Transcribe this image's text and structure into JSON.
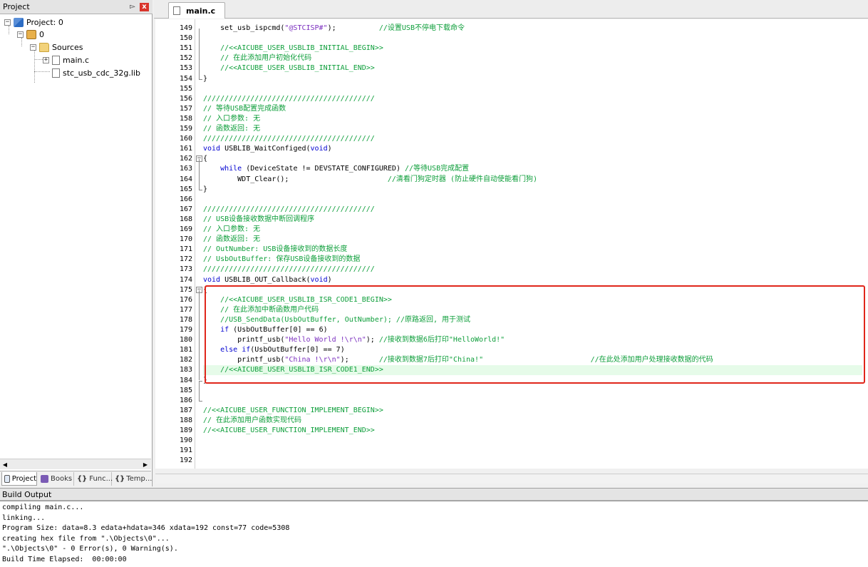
{
  "project_panel": {
    "title": "Project",
    "tree": {
      "project_label": "Project: 0",
      "target_label": "0",
      "group_label": "Sources",
      "files": [
        "main.c",
        "stc_usb_cdc_32g.lib"
      ]
    },
    "tabs": [
      "Project",
      "Books",
      "Func...",
      "Temp..."
    ]
  },
  "editor": {
    "active_tab": "main.c",
    "lines": [
      {
        "n": "149",
        "text": "    set_usb_ispcmd(\"@STCISP#\");          //设置USB不停电下载命令"
      },
      {
        "n": "150",
        "text": ""
      },
      {
        "n": "151",
        "text": "    //<<AICUBE_USER_USBLIB_INITIAL_BEGIN>>"
      },
      {
        "n": "152",
        "text": "    // 在此添加用户初始化代码"
      },
      {
        "n": "153",
        "text": "    //<<AICUBE_USER_USBLIB_INITIAL_END>>"
      },
      {
        "n": "154",
        "text": "}"
      },
      {
        "n": "155",
        "text": ""
      },
      {
        "n": "156",
        "text": "////////////////////////////////////////"
      },
      {
        "n": "157",
        "text": "// 等待USB配置完成函数"
      },
      {
        "n": "158",
        "text": "// 入口参数: 无"
      },
      {
        "n": "159",
        "text": "// 函数返回: 无"
      },
      {
        "n": "160",
        "text": "////////////////////////////////////////"
      },
      {
        "n": "161",
        "text": "void USBLIB_WaitConfiged(void)"
      },
      {
        "n": "162",
        "text": "{"
      },
      {
        "n": "163",
        "text": "    while (DeviceState != DEVSTATE_CONFIGURED) //等待USB完成配置"
      },
      {
        "n": "164",
        "text": "        WDT_Clear();                       //清看门狗定时器 (防止硬件自动使能看门狗)"
      },
      {
        "n": "165",
        "text": "}"
      },
      {
        "n": "166",
        "text": ""
      },
      {
        "n": "167",
        "text": "////////////////////////////////////////"
      },
      {
        "n": "168",
        "text": "// USB设备接收数据中断回调程序"
      },
      {
        "n": "169",
        "text": "// 入口参数: 无"
      },
      {
        "n": "170",
        "text": "// 函数返回: 无"
      },
      {
        "n": "171",
        "text": "// OutNumber: USB设备接收到的数据长度"
      },
      {
        "n": "172",
        "text": "// UsbOutBuffer: 保存USB设备接收到的数据"
      },
      {
        "n": "173",
        "text": "////////////////////////////////////////"
      },
      {
        "n": "174",
        "text": "void USBLIB_OUT_Callback(void)"
      },
      {
        "n": "175",
        "text": "{"
      },
      {
        "n": "176",
        "text": "    //<<AICUBE_USER_USBLIB_ISR_CODE1_BEGIN>>"
      },
      {
        "n": "177",
        "text": "    // 在此添加中断函数用户代码"
      },
      {
        "n": "178",
        "text": "    //USB_SendData(UsbOutBuffer, OutNumber); //原路返回, 用于测试"
      },
      {
        "n": "179",
        "text": "    if (UsbOutBuffer[0] == 6)"
      },
      {
        "n": "180",
        "text": "        printf_usb(\"Hello World !\\r\\n\"); //接收到数据6后打印\"HelloWorld!\""
      },
      {
        "n": "181",
        "text": "    else if(UsbOutBuffer[0] == 7)"
      },
      {
        "n": "182",
        "text": "        printf_usb(\"China !\\r\\n\");       //接收到数据7后打印\"China!\"                         //在此处添加用户处理接收数据的代码"
      },
      {
        "n": "183",
        "text": "    //<<AICUBE_USER_USBLIB_ISR_CODE1_END>>"
      },
      {
        "n": "184",
        "text": "}"
      },
      {
        "n": "185",
        "text": ""
      },
      {
        "n": "186",
        "text": ""
      },
      {
        "n": "187",
        "text": "//<<AICUBE_USER_FUNCTION_IMPLEMENT_BEGIN>>"
      },
      {
        "n": "188",
        "text": "// 在此添加用户函数实现代码"
      },
      {
        "n": "189",
        "text": "//<<AICUBE_USER_FUNCTION_IMPLEMENT_END>>"
      },
      {
        "n": "190",
        "text": ""
      },
      {
        "n": "191",
        "text": ""
      },
      {
        "n": "192",
        "text": ""
      }
    ]
  },
  "build_output": {
    "title": "Build Output",
    "lines": [
      "compiling main.c...",
      "linking...",
      "Program Size: data=8.3 edata+hdata=346 xdata=192 const=77 code=5308",
      "creating hex file from \".\\Objects\\0\"...",
      "\".\\Objects\\0\" - 0 Error(s), 0 Warning(s).",
      "Build Time Elapsed:  00:00:00"
    ]
  },
  "colors": {
    "comment": "#0d9e3a",
    "keyword": "#0000d0",
    "string": "#7b2fbf",
    "highlight_box": "#e0261b",
    "highlighted_line": "#e6fbe9"
  },
  "icons": {
    "panel_pin": "pin-icon",
    "panel_close": "close-icon",
    "project": "project-icon",
    "target": "target-icon",
    "folder": "folder-icon",
    "file": "file-icon"
  }
}
